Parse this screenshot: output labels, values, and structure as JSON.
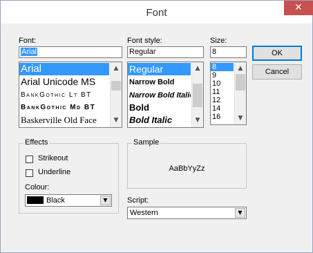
{
  "window": {
    "title": "Font",
    "close_glyph": "✕"
  },
  "font": {
    "label": "Font:",
    "value": "Arial",
    "items": [
      "Arial",
      "Arial Unicode MS",
      "BankGothic Lt BT",
      "BankGothic Md BT",
      "Baskerville Old Face"
    ],
    "selected_index": 0
  },
  "style": {
    "label": "Font style:",
    "value": "Regular",
    "items": [
      "Regular",
      "Narrow Bold",
      "Narrow Bold Italic",
      "Bold",
      "Bold Italic"
    ],
    "selected_index": 0
  },
  "size": {
    "label": "Size:",
    "value": "8",
    "items": [
      "8",
      "9",
      "10",
      "11",
      "12",
      "14",
      "16"
    ],
    "selected_index": 0
  },
  "buttons": {
    "ok": "OK",
    "cancel": "Cancel"
  },
  "effects": {
    "title": "Effects",
    "strikeout": {
      "label": "Strikeout",
      "checked": false
    },
    "underline": {
      "label": "Underline",
      "checked": false
    },
    "colour_label": "Colour:",
    "colour_value": "Black",
    "colour_swatch": "#000000"
  },
  "sample": {
    "title": "Sample",
    "text": "AaBbYyZz"
  },
  "script": {
    "label": "Script:",
    "value": "Western"
  },
  "icons": {
    "up": "▲",
    "down": "▼",
    "dropdown": "▼"
  },
  "colors": {
    "selection": "#3399ff",
    "close_button": "#c75050"
  }
}
